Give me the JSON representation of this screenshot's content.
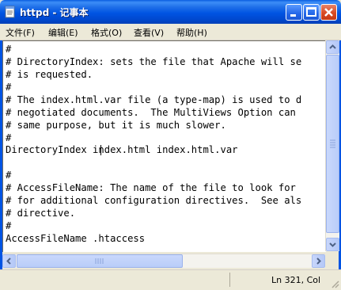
{
  "window": {
    "title": "httpd - 记事本",
    "app_icon": "notepad-icon",
    "controls": [
      "minimize-icon",
      "maximize-icon",
      "close-icon"
    ]
  },
  "menu": {
    "file": "文件(F)",
    "edit": "编辑(E)",
    "format": "格式(O)",
    "view": "查看(V)",
    "help": "帮助(H)"
  },
  "editor": {
    "lines": [
      "#",
      "# DirectoryIndex: sets the file that Apache will se",
      "# is requested.",
      "#",
      "# The index.html.var file (a type-map) is used to d",
      "# negotiated documents.  The MultiViews Option can",
      "# same purpose, but it is much slower.",
      "#",
      "DirectoryIndex index.html index.html.var",
      "",
      "#",
      "# AccessFileName: The name of the file to look for",
      "# for additional configuration directives.  See als",
      "# directive.",
      "#",
      "AccessFileName .htaccess"
    ]
  },
  "statusbar": {
    "position": "Ln 321, Col"
  },
  "colors": {
    "titlebar": "#0054e3",
    "close_button": "#d94a22",
    "window_face": "#ece9d8",
    "scrollbar": "#b9cdf9"
  }
}
